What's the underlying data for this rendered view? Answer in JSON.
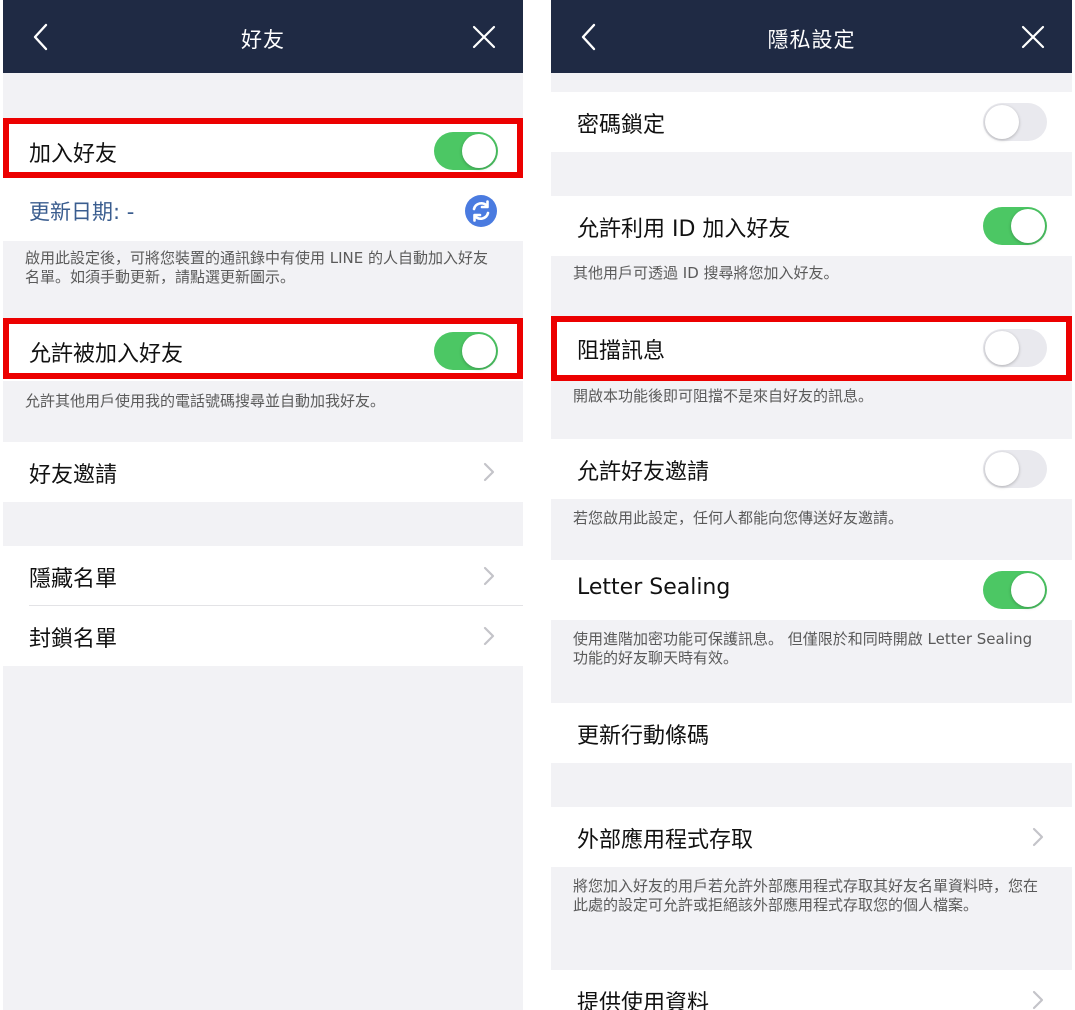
{
  "left": {
    "title": "好友",
    "add_friends": {
      "label": "加入好友",
      "enabled": true
    },
    "update_date": "更新日期: -",
    "add_friends_desc": "啟用此設定後，可將您裝置的通訊錄中有使用 LINE 的人自動加入好友名單。如須手動更新，請點選更新圖示。",
    "allow_added": {
      "label": "允許被加入好友",
      "enabled": true
    },
    "allow_added_desc": "允許其他用戶使用我的電話號碼搜尋並自動加我好友。",
    "invitations": "好友邀請",
    "hidden_list": "隱藏名單",
    "blocked_list": "封鎖名單"
  },
  "right": {
    "title": "隱私設定",
    "passcode": {
      "label": "密碼鎖定",
      "enabled": false
    },
    "allow_id": {
      "label": "允許利用 ID 加入好友",
      "enabled": true
    },
    "allow_id_desc": "其他用戶可透過 ID 搜尋將您加入好友。",
    "block_messages": {
      "label": "阻擋訊息",
      "enabled": false
    },
    "block_messages_desc": "開啟本功能後即可阻擋不是來自好友的訊息。",
    "allow_invites": {
      "label": "允許好友邀請",
      "enabled": false
    },
    "allow_invites_desc": "若您啟用此設定，任何人都能向您傳送好友邀請。",
    "letter_sealing": {
      "label": "Letter Sealing",
      "enabled": true
    },
    "letter_sealing_desc": "使用進階加密功能可保護訊息。 但僅限於和同時開啟 Letter Sealing 功能的好友聊天時有效。",
    "update_qr": "更新行動條碼",
    "external_apps": "外部應用程式存取",
    "external_apps_desc": "將您加入好友的用戶若允許外部應用程式存取其好友名單資料時，您在此處的設定可允許或拒絕該外部應用程式存取您的個人檔案。",
    "provide_data": "提供使用資料"
  },
  "colors": {
    "navbar": "#1f2a44",
    "toggle_on": "#4cc764",
    "highlight": "#ec0000",
    "refresh_icon": "#4a7be0"
  }
}
